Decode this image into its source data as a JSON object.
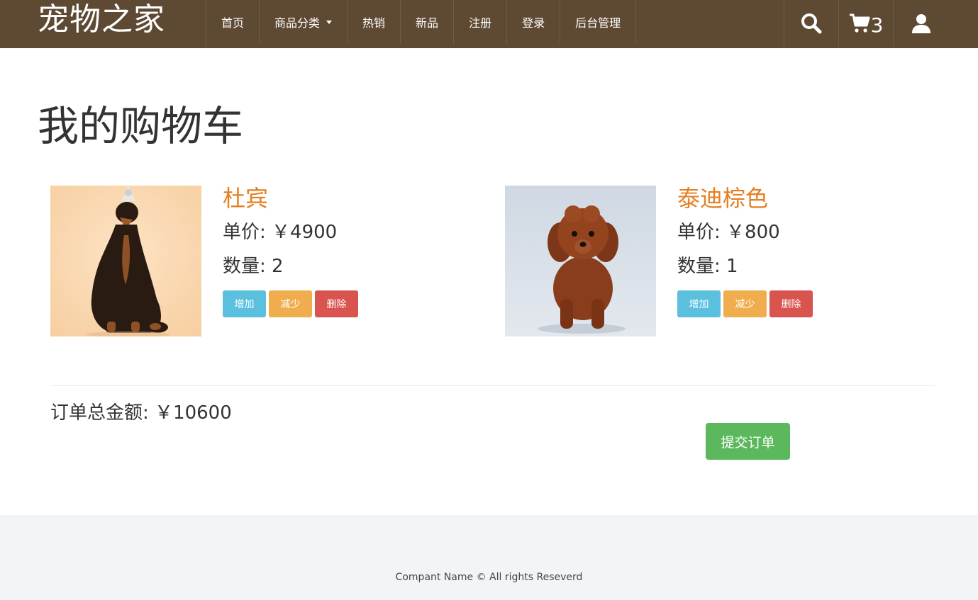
{
  "navbar": {
    "brand": "宠物之家",
    "items": [
      {
        "label": "首页"
      },
      {
        "label": "商品分类",
        "has_caret": true
      },
      {
        "label": "热销"
      },
      {
        "label": "新品"
      },
      {
        "label": "注册"
      },
      {
        "label": "登录"
      },
      {
        "label": "后台管理"
      }
    ],
    "icons": {
      "search": "search-icon",
      "cart": "cart-icon",
      "user": "user-icon"
    },
    "cart_count": "3",
    "color": "#5e4a33"
  },
  "main": {
    "title": "我的购物车",
    "products": [
      {
        "name": "杜宾",
        "price": "单价: ￥4900",
        "quantity": "数量: 2",
        "buttons": {
          "add": "增加",
          "reduce": "减少",
          "delete": "删除"
        }
      },
      {
        "name": "泰迪棕色",
        "price": "单价: ￥800",
        "quantity": "数量: 1",
        "buttons": {
          "add": "增加",
          "reduce": "减少",
          "delete": "删除"
        }
      }
    ],
    "total": "订单总金额: ￥10600",
    "submit_label": "提交订单"
  },
  "footer": {
    "text": "Compant Name © All rights Reseverd"
  },
  "colors": {
    "accent_name": "#e67e22",
    "info": "#5bc0de",
    "warning": "#f0ad4e",
    "danger": "#d9534f",
    "success": "#5cb85c"
  }
}
